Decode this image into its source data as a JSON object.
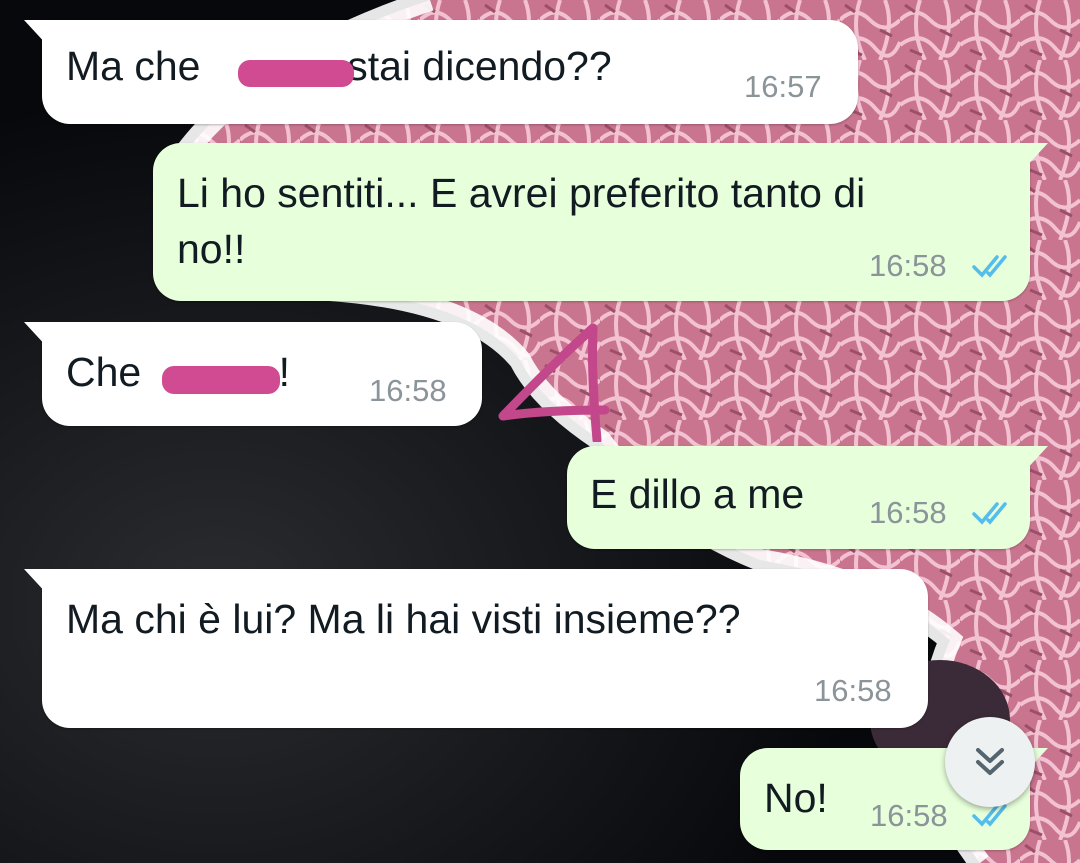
{
  "conversation": {
    "messages": [
      {
        "direction": "incoming",
        "text_before": "Ma che ",
        "text_after": " stai dicendo??",
        "time": "16:57",
        "redacted": true
      },
      {
        "direction": "outgoing",
        "line1": "Li ho sentiti... E avrei preferito tanto di",
        "line2": "no!!",
        "time": "16:58",
        "status": "read"
      },
      {
        "direction": "incoming",
        "text_before": "Che ",
        "text_after": "!",
        "time": "16:58",
        "redacted": true
      },
      {
        "direction": "outgoing",
        "text": "E dillo a me",
        "time": "16:58",
        "status": "read"
      },
      {
        "direction": "incoming",
        "text": "Ma chi è lui? Ma li hai visti insieme??",
        "time": "16:58"
      },
      {
        "direction": "outgoing",
        "text": "No!",
        "time": "16:58",
        "status": "read"
      }
    ]
  },
  "annotation": {
    "text": "4",
    "color": "#c2478b"
  },
  "colors": {
    "incoming_bubble": "#ffffff",
    "outgoing_bubble": "#e7ffdb",
    "read_ticks": "#53bdeb",
    "redaction": "#d04b92"
  },
  "icons": {
    "scroll_down": "double-chevron-down-icon",
    "read_status": "double-check-icon"
  }
}
